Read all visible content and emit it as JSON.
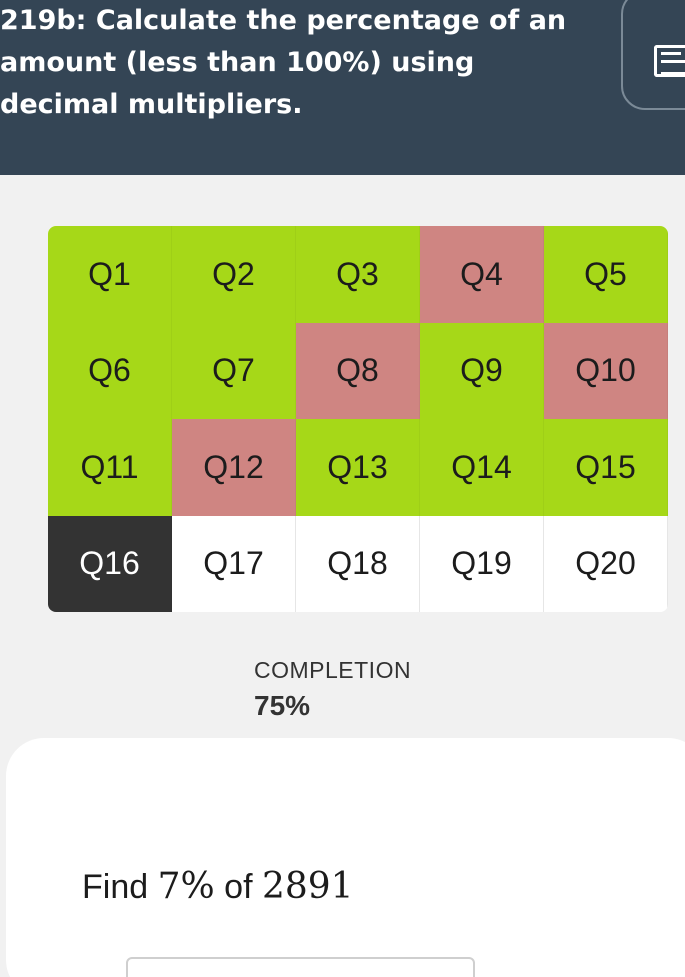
{
  "header": {
    "title": "219b: Calculate the percentage of an amount (less than 100%) using decimal multipliers."
  },
  "questions": [
    {
      "label": "Q1",
      "status": "correct"
    },
    {
      "label": "Q2",
      "status": "correct"
    },
    {
      "label": "Q3",
      "status": "correct"
    },
    {
      "label": "Q4",
      "status": "wrong"
    },
    {
      "label": "Q5",
      "status": "correct"
    },
    {
      "label": "Q6",
      "status": "correct"
    },
    {
      "label": "Q7",
      "status": "correct"
    },
    {
      "label": "Q8",
      "status": "wrong"
    },
    {
      "label": "Q9",
      "status": "correct"
    },
    {
      "label": "Q10",
      "status": "wrong"
    },
    {
      "label": "Q11",
      "status": "correct"
    },
    {
      "label": "Q12",
      "status": "wrong"
    },
    {
      "label": "Q13",
      "status": "correct"
    },
    {
      "label": "Q14",
      "status": "correct"
    },
    {
      "label": "Q15",
      "status": "correct"
    },
    {
      "label": "Q16",
      "status": "current"
    },
    {
      "label": "Q17",
      "status": "pending"
    },
    {
      "label": "Q18",
      "status": "pending"
    },
    {
      "label": "Q19",
      "status": "pending"
    },
    {
      "label": "Q20",
      "status": "pending"
    }
  ],
  "completion": {
    "label": "COMPLETION",
    "value": "75%"
  },
  "question": {
    "prefix": "Find ",
    "percent": "7%",
    "middle": " of ",
    "amount": "2891"
  },
  "colors": {
    "header": "#344555",
    "correct": "#a6d818",
    "wrong": "#cf8582",
    "current": "#333333"
  }
}
